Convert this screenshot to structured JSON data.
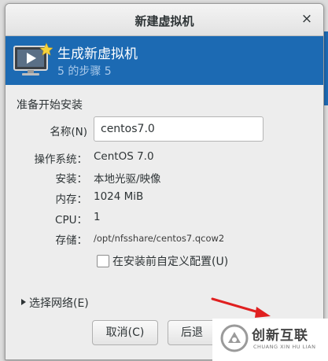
{
  "window": {
    "title": "新建虚拟机",
    "close_glyph": "×"
  },
  "banner": {
    "heading": "生成新虚拟机",
    "step": "5 的步骤 5",
    "icon": "monitor-with-star-icon"
  },
  "section_title": "准备开始安装",
  "form": {
    "name_label": "名称(N)",
    "name_value": "centos7.0",
    "os_label": "操作系统：",
    "os_value": "CentOS 7.0",
    "install_label": "安装：",
    "install_value": "本地光驱/映像",
    "memory_label": "内存：",
    "memory_value": "1024 MiB",
    "cpu_label": "CPU：",
    "cpu_value": "1",
    "storage_label": "存储：",
    "storage_value": "/opt/nfsshare/centos7.qcow2",
    "customize_label": "在安装前自定义配置(U)"
  },
  "network": {
    "label": "选择网络(E)"
  },
  "buttons": {
    "cancel": "取消(C)",
    "back": "后退"
  },
  "watermark": {
    "brand": "创新互联",
    "sub": "CHUANG XIN HU LIAN"
  },
  "colors": {
    "banner": "#1c6ab3",
    "arrow": "#e02020"
  }
}
